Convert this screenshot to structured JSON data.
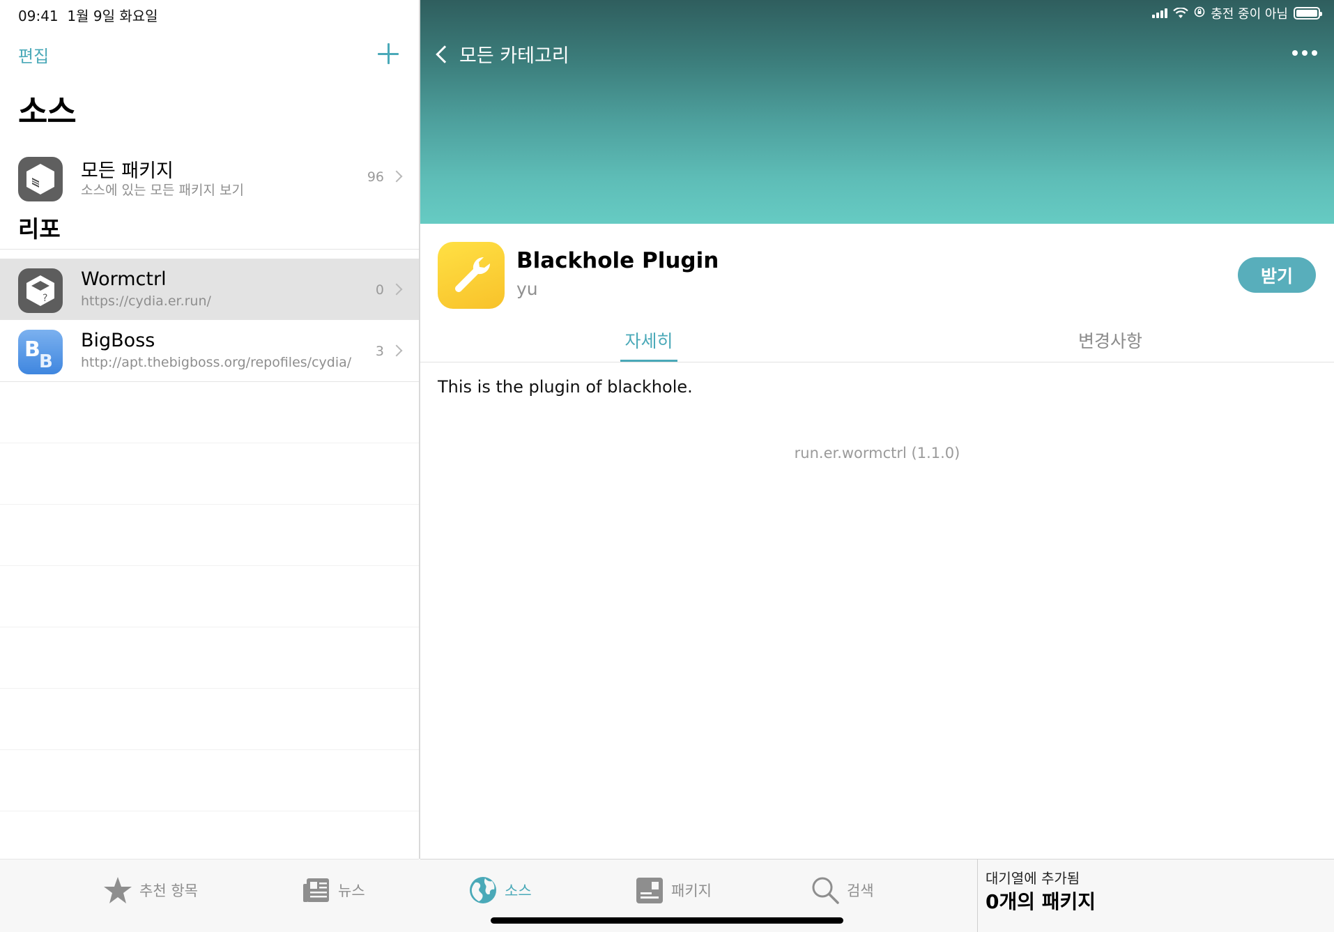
{
  "status_bar": {
    "time": "09:41",
    "date": "1월 9일 화요일",
    "charging": "충전 중이 아님"
  },
  "sidebar": {
    "edit_label": "편집",
    "title": "소스",
    "all_packages": {
      "name": "모든 패키지",
      "subtitle": "소스에 있는 모든 패키지 보기",
      "count": "96"
    },
    "repos_title": "리포",
    "repos": [
      {
        "name": "Wormctrl",
        "url": "https://cydia.er.run/",
        "count": "0",
        "icon": "wormctrl-icon",
        "selected": true
      },
      {
        "name": "BigBoss",
        "url": "http://apt.thebigboss.org/repofiles/cydia/",
        "count": "3",
        "icon": "bigboss-icon",
        "selected": false
      }
    ]
  },
  "detail": {
    "back_label": "모든 카테고리",
    "package_name": "Blackhole Plugin",
    "author": "yu",
    "get_label": "받기",
    "tabs": [
      {
        "label": "자세히",
        "active": true
      },
      {
        "label": "변경사항",
        "active": false
      }
    ],
    "description": "This is the plugin of blackhole.",
    "package_id": "run.er.wormctrl (1.1.0)",
    "accent_color": "#4aa9b8",
    "banner_colors": [
      "#2f5e5e",
      "#66cbc3"
    ]
  },
  "tab_bar": {
    "items": [
      {
        "label": "추천 항목",
        "icon": "star-icon",
        "active": false
      },
      {
        "label": "뉴스",
        "icon": "news-icon",
        "active": false
      },
      {
        "label": "소스",
        "icon": "globe-icon",
        "active": true
      },
      {
        "label": "패키지",
        "icon": "package-icon",
        "active": false
      },
      {
        "label": "검색",
        "icon": "search-icon",
        "active": false
      }
    ],
    "queue_label": "대기열에 추가됨",
    "queue_count": "0개의 패키지"
  }
}
